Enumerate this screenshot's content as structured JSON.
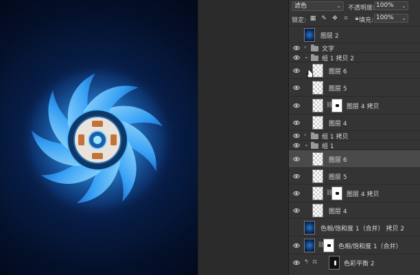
{
  "panel": {
    "blend_mode": "滤色",
    "opacity_label": "不透明度:",
    "opacity_value": "100%",
    "lock_label": "锁定:",
    "fill_label": "填充:",
    "fill_value": "100%"
  },
  "layers": [
    {
      "name": "图层 2",
      "kind": "photo"
    },
    {
      "name": "文字",
      "kind": "group"
    },
    {
      "name": "组 1 拷贝 2",
      "kind": "group"
    },
    {
      "name": "图层 6",
      "kind": "layer"
    },
    {
      "name": "图层 5",
      "kind": "layer"
    },
    {
      "name": "图层 4 拷贝",
      "kind": "layer-mask"
    },
    {
      "name": "图层 4",
      "kind": "layer"
    },
    {
      "name": "组 1 拷贝",
      "kind": "group"
    },
    {
      "name": "组 1",
      "kind": "group"
    },
    {
      "name": "图层 6",
      "kind": "layer",
      "selected": true
    },
    {
      "name": "图层 5",
      "kind": "layer"
    },
    {
      "name": "图层 4 拷贝",
      "kind": "layer-mask"
    },
    {
      "name": "图层 4",
      "kind": "layer"
    },
    {
      "name": "色相/饱和度 1（合并） 拷贝 2",
      "kind": "photo"
    },
    {
      "name": "色相/饱和度 1（合并）",
      "kind": "photo-mask"
    },
    {
      "name": "色彩平衡 2",
      "kind": "adjustment"
    }
  ],
  "colors": {
    "canvas_bg": "#04102a",
    "fan_blade": "#3aa8ff",
    "hub": "#0d3766",
    "panel_bg": "#343434",
    "selected_row": "#4a4a4a"
  }
}
